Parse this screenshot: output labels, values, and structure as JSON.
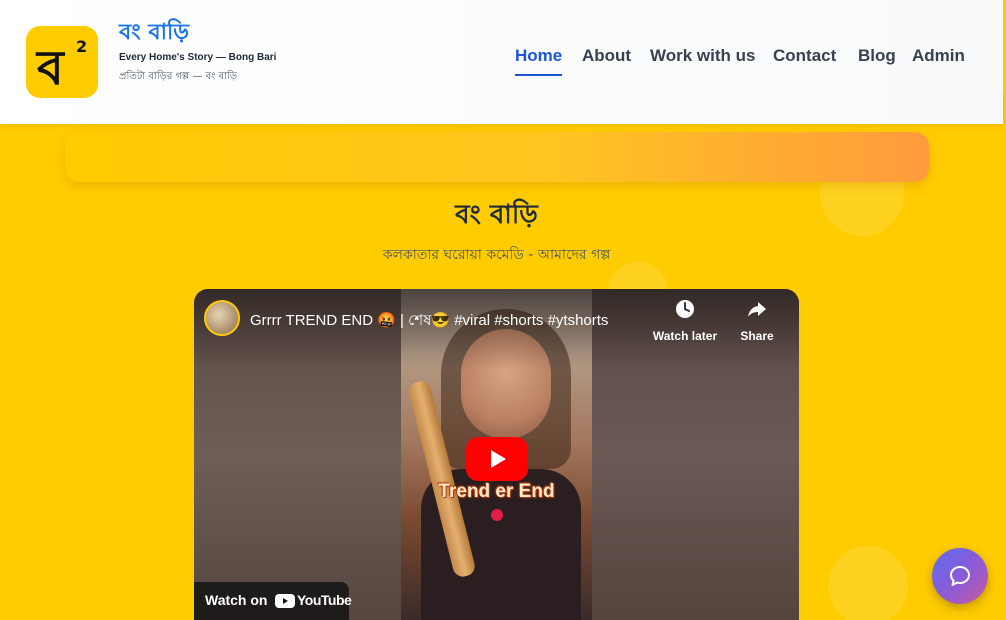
{
  "brand": {
    "logo_char": "ব",
    "logo_sup": "2",
    "title": "বং বাড়ি",
    "tagline": "Every Home's Story — Bong Bari",
    "subtitle": "প্রতিটা বাড়ির গল্প — বং বাড়ি",
    "logo_color": "#ffcc00",
    "title_color": "#1a73e8"
  },
  "nav": {
    "items": [
      {
        "label": "Home",
        "active": true
      },
      {
        "label": "About",
        "active": false
      },
      {
        "label": "Work with us",
        "active": false
      },
      {
        "label": "Contact",
        "active": false
      },
      {
        "label": "Blog",
        "active": false
      },
      {
        "label": "Admin",
        "active": false
      }
    ],
    "active_color": "#1a56db"
  },
  "hero": {
    "title": "বং বাড়ি",
    "subtitle": "কলকাতার ঘরোয়া কমেডি - আমাদের গল্প"
  },
  "video": {
    "title": "Grrrr TREND END 🤬 | শেষ😎 #viral #shorts #ytshorts",
    "watch_later": "Watch later",
    "share": "Share",
    "overlay_text": "Trend er End",
    "watch_on": "Watch on",
    "youtube": "YouTube",
    "icons": [
      "clock-icon",
      "share-arrow-icon",
      "play-icon",
      "youtube-logo-icon"
    ]
  },
  "chat": {
    "icon": "chat-bubble-icon"
  },
  "colors": {
    "page_bg": "#ffcc00",
    "banner_end": "#ff9a3d",
    "youtube_red": "#ff0000"
  }
}
